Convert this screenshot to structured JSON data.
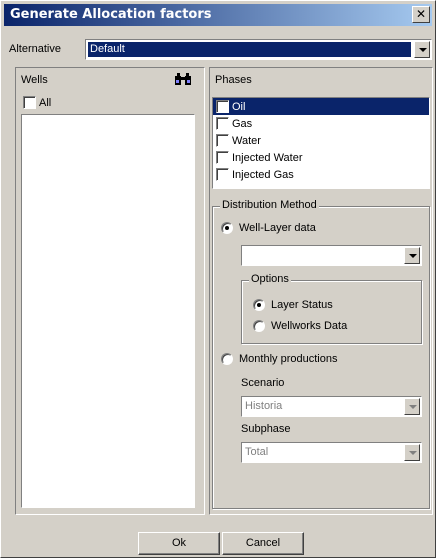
{
  "window": {
    "title": "Generate Allocation factors",
    "close_glyph": "✕"
  },
  "alternative": {
    "label": "Alternative",
    "value": "Default"
  },
  "wells": {
    "label": "Wells",
    "search_icon": "binoculars-icon",
    "all_label": "All",
    "items": []
  },
  "phases": {
    "label": "Phases",
    "items": [
      {
        "label": "Oil",
        "selected": true
      },
      {
        "label": "Gas",
        "selected": false
      },
      {
        "label": "Water",
        "selected": false
      },
      {
        "label": "Injected Water",
        "selected": false
      },
      {
        "label": "Injected Gas",
        "selected": false
      }
    ]
  },
  "distribution": {
    "title": "Distribution Method",
    "well_layer_label": "Well-Layer data",
    "well_layer_value": "",
    "options": {
      "title": "Options",
      "layer_status_label": "Layer Status",
      "wellworks_label": "Wellworks Data"
    },
    "monthly_label": "Monthly productions",
    "scenario_label": "Scenario",
    "scenario_value": "Historia",
    "subphase_label": "Subphase",
    "subphase_value": "Total"
  },
  "buttons": {
    "ok": "Ok",
    "cancel": "Cancel"
  },
  "colors": {
    "selection": "#0a246a",
    "face": "#d4d0c8",
    "title_gradient_end": "#a6caf0"
  }
}
